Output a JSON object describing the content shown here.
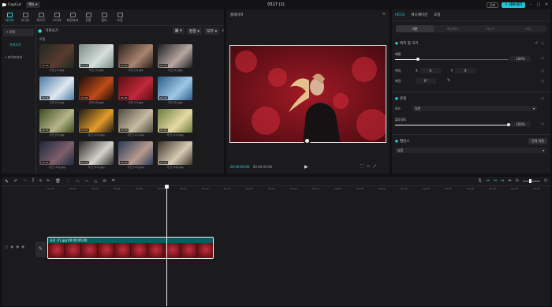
{
  "app": {
    "name": "CapCut",
    "menu_label": "메뉴",
    "title": "0517 (1)",
    "shortcut_label": "단축",
    "export_label": "내보내기"
  },
  "tools": [
    {
      "label": "미디어",
      "active": true
    },
    {
      "label": "오디오"
    },
    {
      "label": "텍스트"
    },
    {
      "label": "스티커"
    },
    {
      "label": "화면효과"
    },
    {
      "label": "전환"
    },
    {
      "label": "필터"
    },
    {
      "label": "조정"
    }
  ],
  "sidebar": {
    "items": [
      {
        "label": "• 로컬",
        "selected": true
      },
      {
        "label": "가져오기",
        "sub": true
      },
      {
        "label": "• 라이브러리"
      }
    ]
  },
  "media": {
    "import_label": "가져오기",
    "section_label": "로컬",
    "sort_label": "정렬",
    "all_label": "모두",
    "items": [
      {
        "name": "사진 (1).jpg",
        "dur": "00:05",
        "c1": "#1d2a20",
        "c2": "#5a3a2e"
      },
      {
        "name": "사진 (2).jpg",
        "dur": "00:05",
        "c1": "#7a8a86",
        "c2": "#d7dedb"
      },
      {
        "name": "사진 (3).jpg",
        "dur": "00:05",
        "c1": "#2a1f1c",
        "c2": "#a8846e"
      },
      {
        "name": "사진 (4).jpg",
        "dur": "00:05",
        "c1": "#1b1d22",
        "c2": "#b8a7a2"
      },
      {
        "name": "사진 (5).jpg",
        "dur": "00:05",
        "c1": "#4a7ba8",
        "c2": "#dfe8ef"
      },
      {
        "name": "사진 (6).jpg",
        "dur": "00:05",
        "c1": "#1a0d08",
        "c2": "#c04a18"
      },
      {
        "name": "사진 (7).jpg",
        "dur": "00:05",
        "c1": "#5b0d12",
        "c2": "#c0283a"
      },
      {
        "name": "사진 (8).jpg",
        "dur": "00:05",
        "c1": "#2a5d8a",
        "c2": "#9fc8e6"
      },
      {
        "name": "사진 (9).jpg",
        "dur": "00:05",
        "c1": "#3a4a1f",
        "c2": "#b7b58a"
      },
      {
        "name": "사진 (10).jpg",
        "dur": "00:05",
        "c1": "#1b1a16",
        "c2": "#e39b2a"
      },
      {
        "name": "사진 (11).jpg",
        "dur": "00:05",
        "c1": "#4e4a3e",
        "c2": "#c7bba3"
      },
      {
        "name": "사진 (12).jpg",
        "dur": "00:05",
        "c1": "#6a7d3a",
        "c2": "#e5d9a5"
      },
      {
        "name": "사진 (13).jpg",
        "dur": "00:05",
        "c1": "#1b2740",
        "c2": "#7e5f6a"
      },
      {
        "name": "사진 (14).jpg",
        "dur": "00:05",
        "c1": "#2a2a2a",
        "c2": "#d6d2cb"
      },
      {
        "name": "사진 (15).jpg",
        "dur": "00:05",
        "c1": "#2a3a5a",
        "c2": "#b59a8c"
      },
      {
        "name": "사진 (16).jpg",
        "dur": "00:05",
        "c1": "#3a3328",
        "c2": "#d8cbb5"
      }
    ]
  },
  "player": {
    "label": "플레이어",
    "time_current": "00:00:00:00",
    "time_total": "00:00:05:00"
  },
  "props": {
    "tabs": [
      "비디오",
      "애니메이션",
      "조정"
    ],
    "subtabs": [
      "기본",
      "배경제거",
      "마스크",
      "보정"
    ],
    "transform_label": "위치 및 크기",
    "scale_label": "배율",
    "scale_value": "100%",
    "position_label": "위치",
    "pos_x": "0",
    "pos_y": "0",
    "x_label": "X",
    "y_label": "Y",
    "rotate_label": "회전",
    "rotate_value": "0°",
    "blend_label": "혼합",
    "mode_label": "모드",
    "mode_value": "일반",
    "opacity_label": "불투명도",
    "opacity_value": "100%",
    "balance_label": "밸런스",
    "apply_all_label": "전체 적용",
    "balance_value": "없음"
  },
  "timeline": {
    "ticks": [
      "00:00",
      "00:02",
      "00:04",
      "00:06",
      "00:08",
      "00:10",
      "00:12",
      "00:14",
      "00:16",
      "00:18",
      "00:20",
      "00:22",
      "00:24",
      "00:26",
      "00:28",
      "00:30",
      "00:32",
      "00:34",
      "00:36",
      "00:38",
      "00:40",
      "00:42",
      "00:44"
    ],
    "clip_label": "사진 (7).jpg  00:00:05:00"
  }
}
